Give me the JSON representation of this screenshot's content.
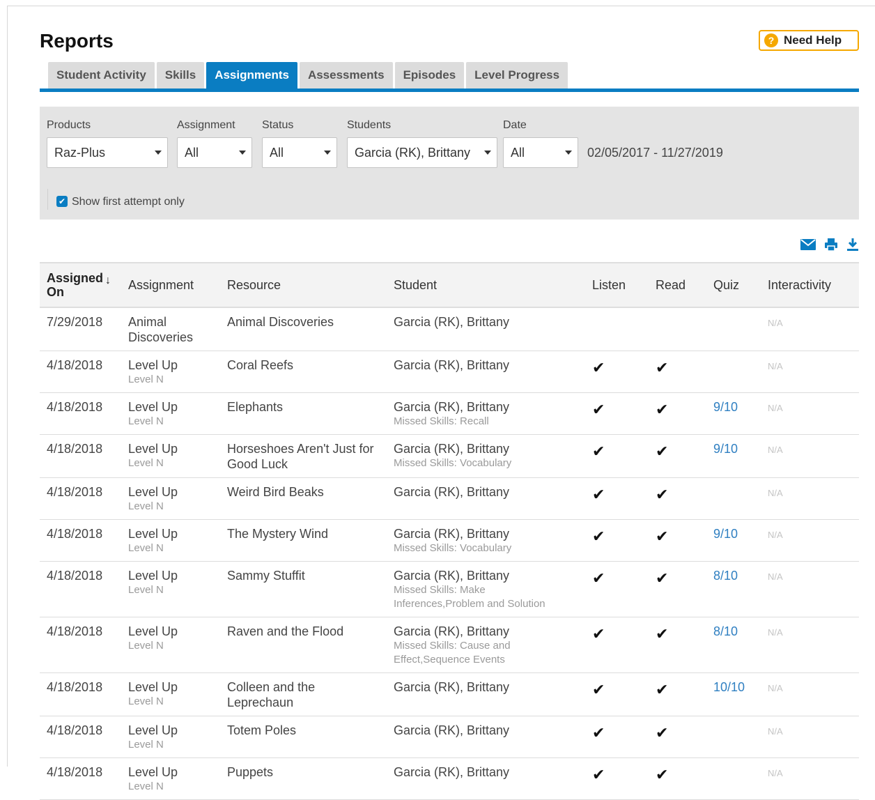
{
  "header": {
    "title": "Reports",
    "help_label": "Need Help",
    "help_icon": "question-icon"
  },
  "tabs": [
    {
      "label": "Student Activity",
      "active": false
    },
    {
      "label": "Skills",
      "active": false
    },
    {
      "label": "Assignments",
      "active": true
    },
    {
      "label": "Assessments",
      "active": false
    },
    {
      "label": "Episodes",
      "active": false
    },
    {
      "label": "Level Progress",
      "active": false
    }
  ],
  "filters": {
    "products": {
      "label": "Products",
      "value": "Raz-Plus"
    },
    "assignment": {
      "label": "Assignment",
      "value": "All"
    },
    "status": {
      "label": "Status",
      "value": "All"
    },
    "students": {
      "label": "Students",
      "value": "Garcia (RK), Brittany"
    },
    "date": {
      "label": "Date",
      "value": "All"
    },
    "date_range": "02/05/2017 - 11/27/2019",
    "first_attempt_label": "Show first attempt only",
    "first_attempt_checked": true
  },
  "actions": [
    "email-icon",
    "print-icon",
    "download-icon"
  ],
  "colors": {
    "accent": "#0a7dc2",
    "help": "#f5a800",
    "quiz_link": "#2f7fc1"
  },
  "table": {
    "columns": {
      "assigned_on": "Assigned On",
      "assignment": "Assignment",
      "resource": "Resource",
      "student": "Student",
      "listen": "Listen",
      "read": "Read",
      "quiz": "Quiz",
      "interactivity": "Interactivity"
    },
    "rows": [
      {
        "date": "7/29/2018",
        "assignment": "Animal Discoveries",
        "level": "",
        "resource": "Animal Discoveries",
        "student": "Garcia (RK), Brittany",
        "missed": "",
        "listen": false,
        "read": false,
        "quiz": "",
        "interactivity": "N/A"
      },
      {
        "date": "4/18/2018",
        "assignment": "Level Up",
        "level": "Level N",
        "resource": "Coral Reefs",
        "student": "Garcia (RK), Brittany",
        "missed": "",
        "listen": true,
        "read": true,
        "quiz": "",
        "interactivity": "N/A"
      },
      {
        "date": "4/18/2018",
        "assignment": "Level Up",
        "level": "Level N",
        "resource": "Elephants",
        "student": "Garcia (RK), Brittany",
        "missed": "Missed Skills: Recall",
        "listen": true,
        "read": true,
        "quiz": "9/10",
        "interactivity": "N/A"
      },
      {
        "date": "4/18/2018",
        "assignment": "Level Up",
        "level": "Level N",
        "resource": "Horseshoes Aren't Just for Good Luck",
        "student": "Garcia (RK), Brittany",
        "missed": "Missed Skills: Vocabulary",
        "listen": true,
        "read": true,
        "quiz": "9/10",
        "interactivity": "N/A"
      },
      {
        "date": "4/18/2018",
        "assignment": "Level Up",
        "level": "Level N",
        "resource": "Weird Bird Beaks",
        "student": "Garcia (RK), Brittany",
        "missed": "",
        "listen": true,
        "read": true,
        "quiz": "",
        "interactivity": "N/A"
      },
      {
        "date": "4/18/2018",
        "assignment": "Level Up",
        "level": "Level N",
        "resource": "The Mystery Wind",
        "student": "Garcia (RK), Brittany",
        "missed": "Missed Skills: Vocabulary",
        "listen": true,
        "read": true,
        "quiz": "9/10",
        "interactivity": "N/A"
      },
      {
        "date": "4/18/2018",
        "assignment": "Level Up",
        "level": "Level N",
        "resource": "Sammy Stuffit",
        "student": "Garcia (RK), Brittany",
        "missed": "Missed Skills: Make Inferences,Problem and Solution",
        "listen": true,
        "read": true,
        "quiz": "8/10",
        "interactivity": "N/A"
      },
      {
        "date": "4/18/2018",
        "assignment": "Level Up",
        "level": "Level N",
        "resource": "Raven and the Flood",
        "student": "Garcia (RK), Brittany",
        "missed": "Missed Skills: Cause and Effect,Sequence Events",
        "listen": true,
        "read": true,
        "quiz": "8/10",
        "interactivity": "N/A"
      },
      {
        "date": "4/18/2018",
        "assignment": "Level Up",
        "level": "Level N",
        "resource": "Colleen and the Leprechaun",
        "student": "Garcia (RK), Brittany",
        "missed": "",
        "listen": true,
        "read": true,
        "quiz": "10/10",
        "interactivity": "N/A"
      },
      {
        "date": "4/18/2018",
        "assignment": "Level Up",
        "level": "Level N",
        "resource": "Totem Poles",
        "student": "Garcia (RK), Brittany",
        "missed": "",
        "listen": true,
        "read": true,
        "quiz": "",
        "interactivity": "N/A"
      },
      {
        "date": "4/18/2018",
        "assignment": "Level Up",
        "level": "Level N",
        "resource": "Puppets",
        "student": "Garcia (RK), Brittany",
        "missed": "",
        "listen": true,
        "read": true,
        "quiz": "",
        "interactivity": "N/A"
      }
    ]
  }
}
